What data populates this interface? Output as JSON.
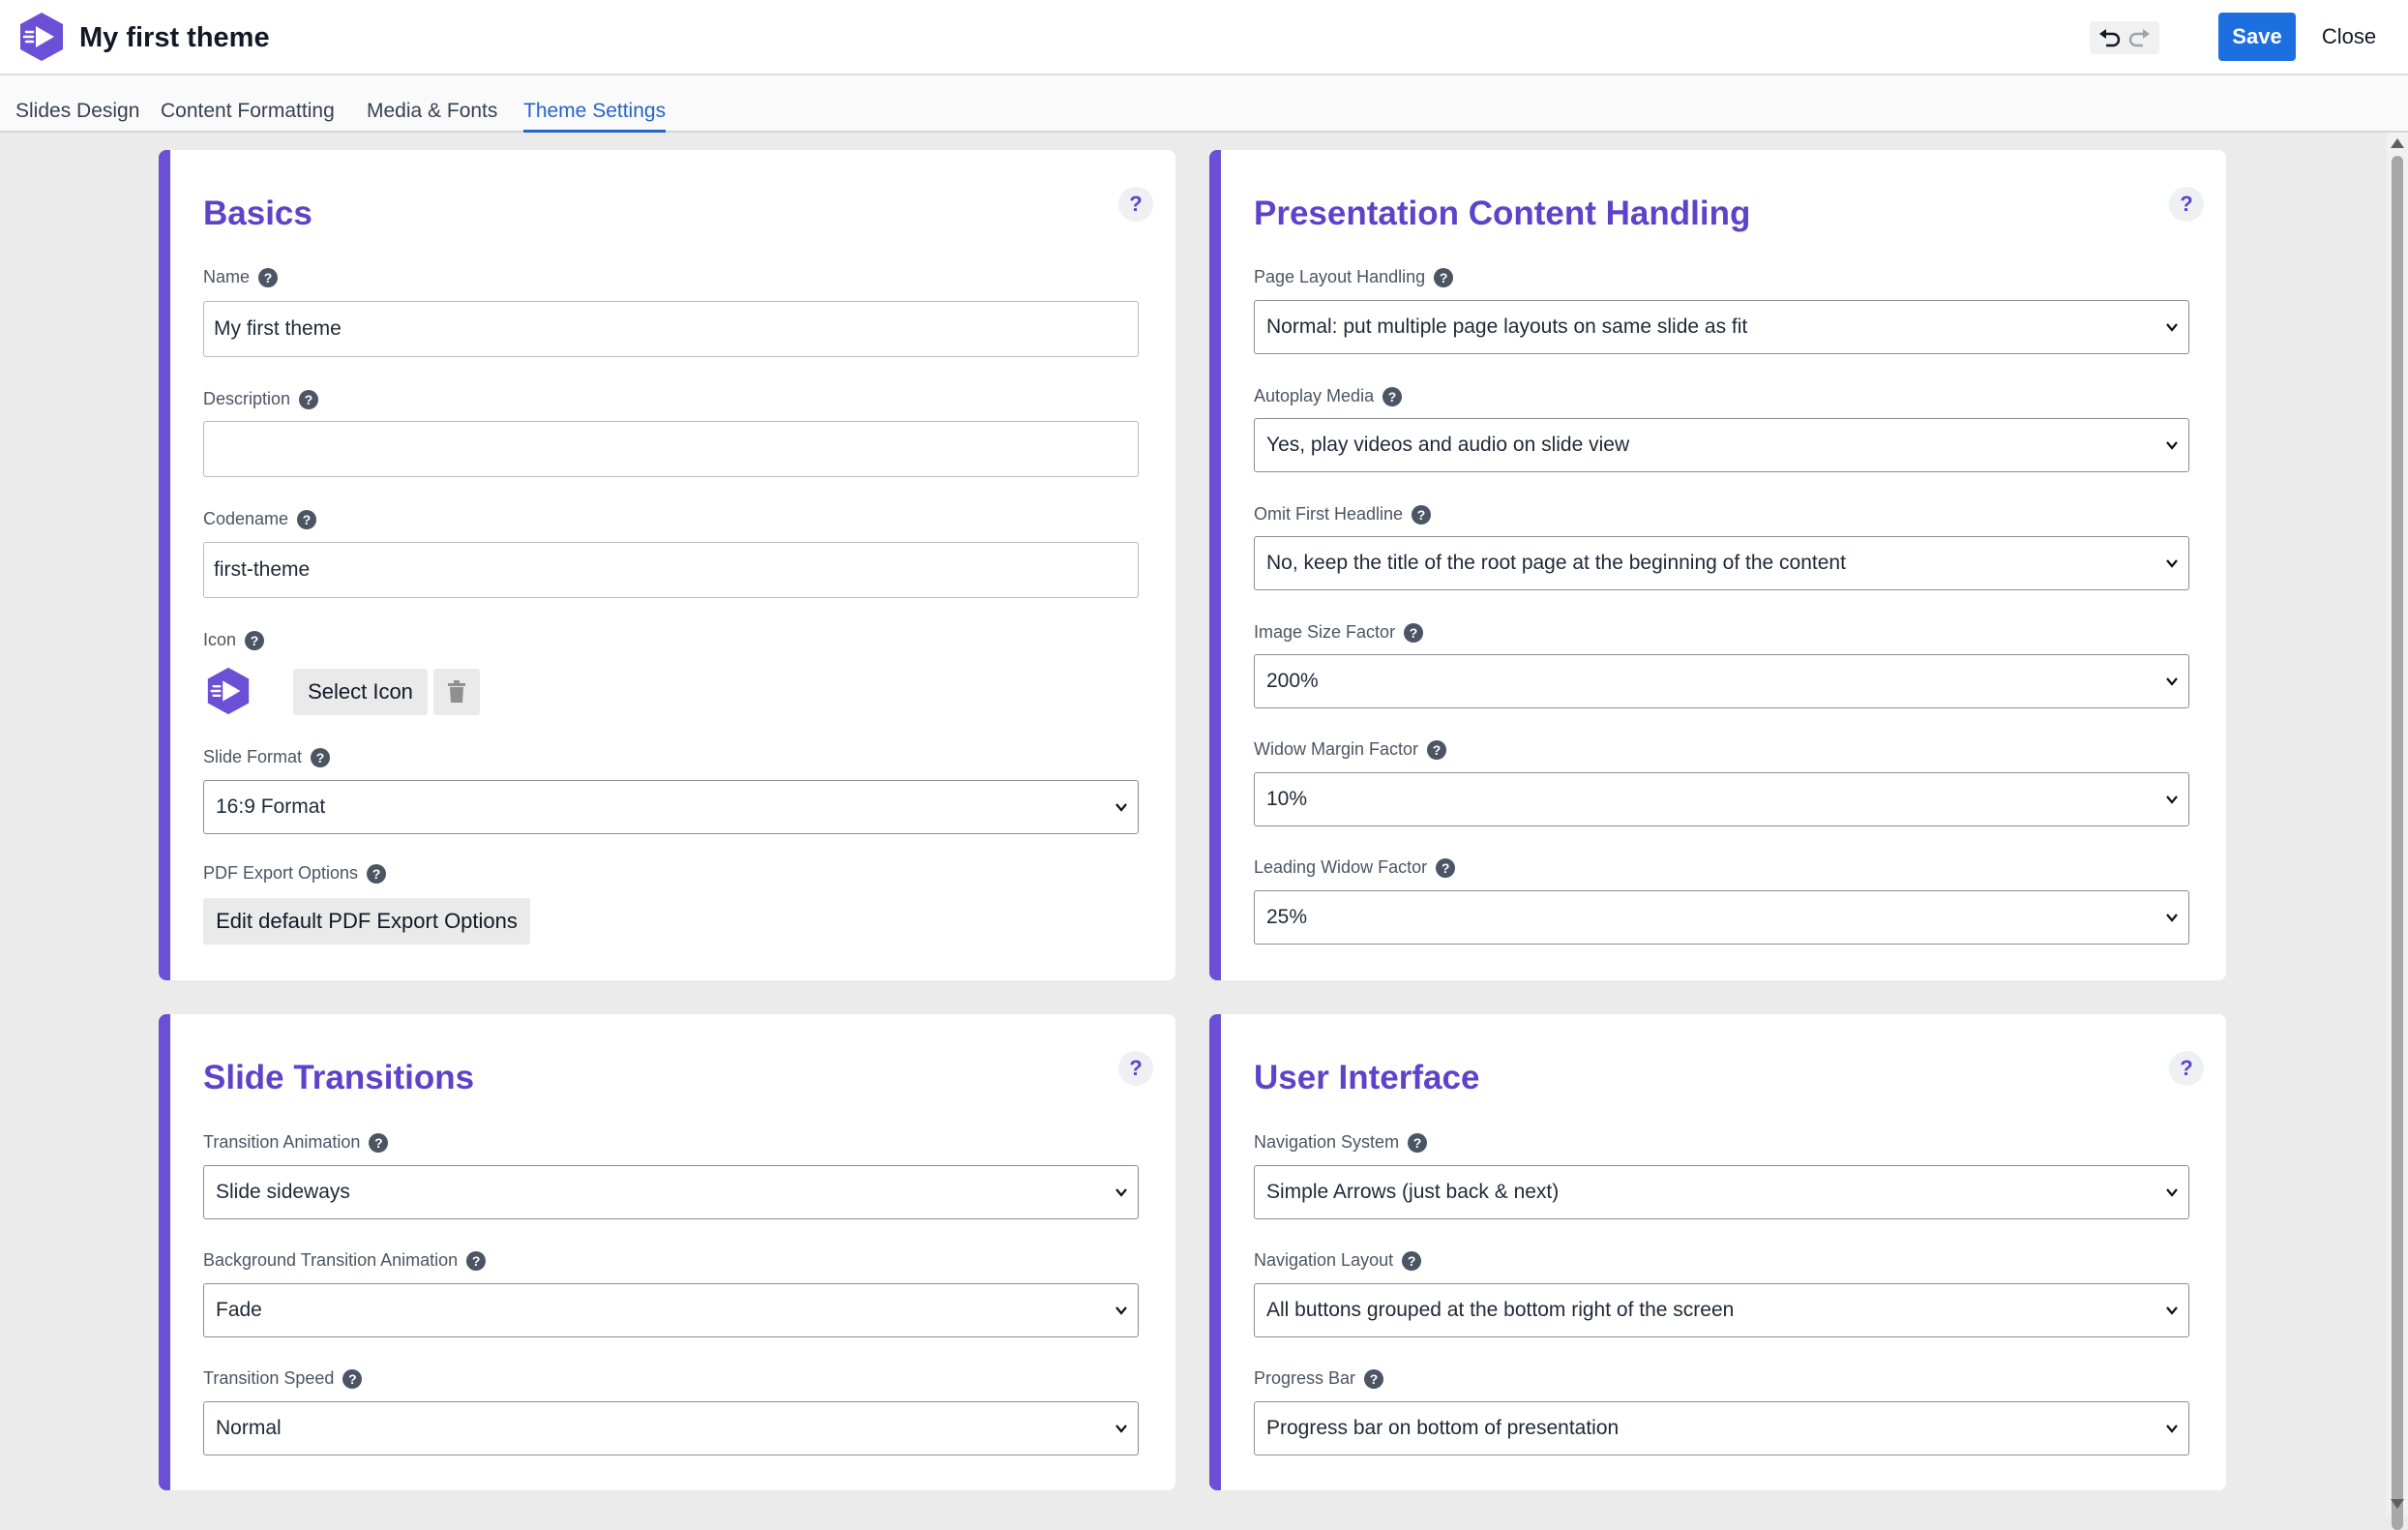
{
  "app": {
    "title": "My first theme",
    "logo_icon": "play-hexagon-icon",
    "accent_color": "#6b4fd6",
    "primary_button_color": "#1d6fe0"
  },
  "header": {
    "undo_icon": "undo-icon",
    "redo_icon": "redo-icon",
    "save_label": "Save",
    "close_label": "Close"
  },
  "tabs": [
    {
      "label": "Slides Design",
      "active": false
    },
    {
      "label": "Content Formatting",
      "active": false
    },
    {
      "label": "Media & Fonts",
      "active": false
    },
    {
      "label": "Theme Settings",
      "active": true
    }
  ],
  "basics": {
    "title": "Basics",
    "help": "?",
    "name_label": "Name",
    "name_value": "My first theme",
    "description_label": "Description",
    "description_value": "",
    "codename_label": "Codename",
    "codename_value": "first-theme",
    "icon_label": "Icon",
    "select_icon_label": "Select Icon",
    "slide_format_label": "Slide Format",
    "slide_format_value": "16:9 Format",
    "pdf_export_label": "PDF Export Options",
    "pdf_export_button": "Edit default PDF Export Options"
  },
  "content_handling": {
    "title": "Presentation Content Handling",
    "help": "?",
    "page_layout_label": "Page Layout Handling",
    "page_layout_value": "Normal: put multiple page layouts on same slide as fit",
    "autoplay_label": "Autoplay Media",
    "autoplay_value": "Yes, play videos and audio on slide view",
    "omit_headline_label": "Omit First Headline",
    "omit_headline_value": "No, keep the title of the root page at the beginning of the content",
    "image_size_label": "Image Size Factor",
    "image_size_value": "200%",
    "widow_margin_label": "Widow Margin Factor",
    "widow_margin_value": "10%",
    "leading_widow_label": "Leading Widow Factor",
    "leading_widow_value": "25%"
  },
  "transitions": {
    "title": "Slide Transitions",
    "help": "?",
    "transition_label": "Transition Animation",
    "transition_value": "Slide sideways",
    "bg_transition_label": "Background Transition Animation",
    "bg_transition_value": "Fade",
    "speed_label": "Transition Speed",
    "speed_value": "Normal"
  },
  "user_interface": {
    "title": "User Interface",
    "help": "?",
    "nav_system_label": "Navigation System",
    "nav_system_value": "Simple Arrows (just back & next)",
    "nav_layout_label": "Navigation Layout",
    "nav_layout_value": "All buttons grouped at the bottom right of the screen",
    "progress_label": "Progress Bar",
    "progress_value": "Progress bar on bottom of presentation"
  },
  "qmark": "?"
}
